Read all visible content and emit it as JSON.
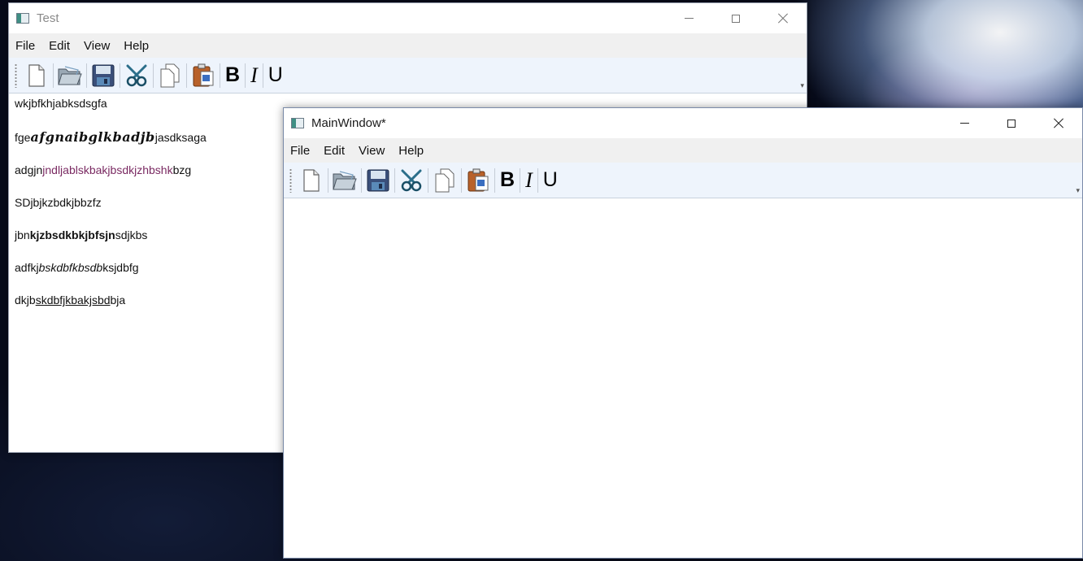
{
  "test_window": {
    "title": "Test",
    "menu": [
      "File",
      "Edit",
      "View",
      "Help"
    ],
    "format_buttons": {
      "bold": "B",
      "italic": "I",
      "underline": "U"
    },
    "extension_glyph": "▾",
    "paragraphs": [
      {
        "plain": "wkjbfkhjabksdsgfa"
      },
      {
        "before": "fge",
        "styled": "afgnaibglkbadjb",
        "after": "jasdksaga",
        "style": "fancy"
      },
      {
        "before": "adgjn",
        "styled": "jndljablskbakjbsdkjzhbshk",
        "after": "bzg",
        "style": "colored",
        "color": "#7a2a62"
      },
      {
        "plain": "SDjbjkzbdkjbbzfz"
      },
      {
        "before": "jbn",
        "styled": "kjzbsdkbkjbfsjn",
        "after": "sdjkbs",
        "style": "bold"
      },
      {
        "before": "adfkj",
        "styled": "bskdbfkbsdb",
        "after": "ksjdbfg",
        "style": "italic"
      },
      {
        "before": "dkjb",
        "styled": "skdbfjkbakjsbd",
        "after": "bja",
        "style": "underline"
      }
    ]
  },
  "main_window": {
    "title": "MainWindow*",
    "menu": [
      "File",
      "Edit",
      "View",
      "Help"
    ],
    "format_buttons": {
      "bold": "B",
      "italic": "I",
      "underline": "U"
    },
    "extension_glyph": "▾"
  },
  "icons": [
    "new-file-icon",
    "open-folder-icon",
    "save-disk-icon",
    "cut-scissors-icon",
    "copy-icon",
    "paste-icon"
  ]
}
